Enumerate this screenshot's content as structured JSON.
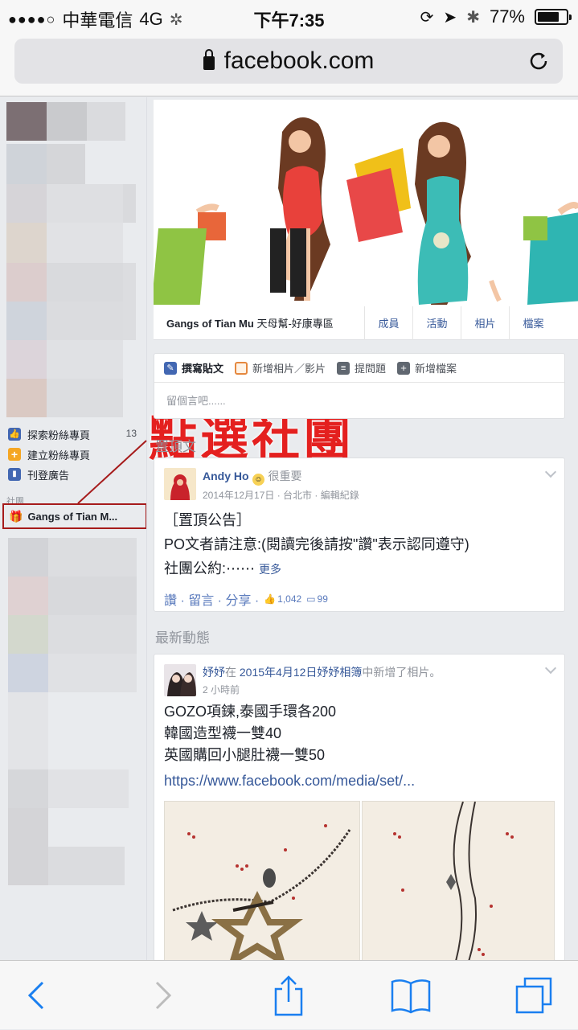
{
  "status_bar": {
    "signal": "●●●●○",
    "carrier": "中華電信",
    "network": "4G",
    "time": "下午7:35",
    "battery_percent": "77%",
    "battery_level": 0.77
  },
  "browser": {
    "url": "facebook.com"
  },
  "sidebar": {
    "items": [
      {
        "label": "探索粉絲專頁",
        "count": "13",
        "icon": "thumbs-up-icon",
        "color": "#4267b2"
      },
      {
        "label": "建立粉絲專頁",
        "count": "",
        "icon": "plus-icon",
        "color": "#f5a623"
      },
      {
        "label": "刊登廣告",
        "count": "",
        "icon": "bar-chart-icon",
        "color": "#4267b2"
      }
    ],
    "groups_header": "社團",
    "group_item": "Gangs of Tian M..."
  },
  "annotation": {
    "callout_text": "點選社團",
    "highlight_color": "#a61b1b",
    "callout_color": "#e4201f"
  },
  "group": {
    "name": "Gangs of Tian Mu",
    "subtitle": "天母幫-好康專區",
    "tabs": [
      "成員",
      "活動",
      "相片",
      "檔案"
    ]
  },
  "composer": {
    "tabs": [
      "撰寫貼文",
      "新增相片／影片",
      "提問題",
      "新增檔案"
    ],
    "placeholder": "留個言吧......"
  },
  "pinned": {
    "section_title": "置頂文",
    "author": "Andy Ho",
    "feeling": "很重要",
    "meta": "2014年12月17日 · 台北市 · 編輯紀錄",
    "lines": [
      "［置頂公告］",
      "PO文者請注意:(閱讀完後請按\"讚\"表示認同遵守)",
      "社團公約:⋯⋯"
    ],
    "more": "更多",
    "actions": "讚 · 留言 · 分享 ·",
    "likes": "1,042",
    "comments": "99"
  },
  "latest": {
    "section_title": "最新動態",
    "author": "妤妤",
    "action_prefix": "在",
    "album": "2015年4月12日妤妤相簿",
    "action_suffix": "中新增了相片。",
    "time": "2 小時前",
    "lines": [
      "GOZO項鍊,泰國手環各200",
      "韓國造型襪一雙40",
      "英國購回小腿肚襪一雙50"
    ],
    "link": "https://www.facebook.com/media/set/..."
  }
}
